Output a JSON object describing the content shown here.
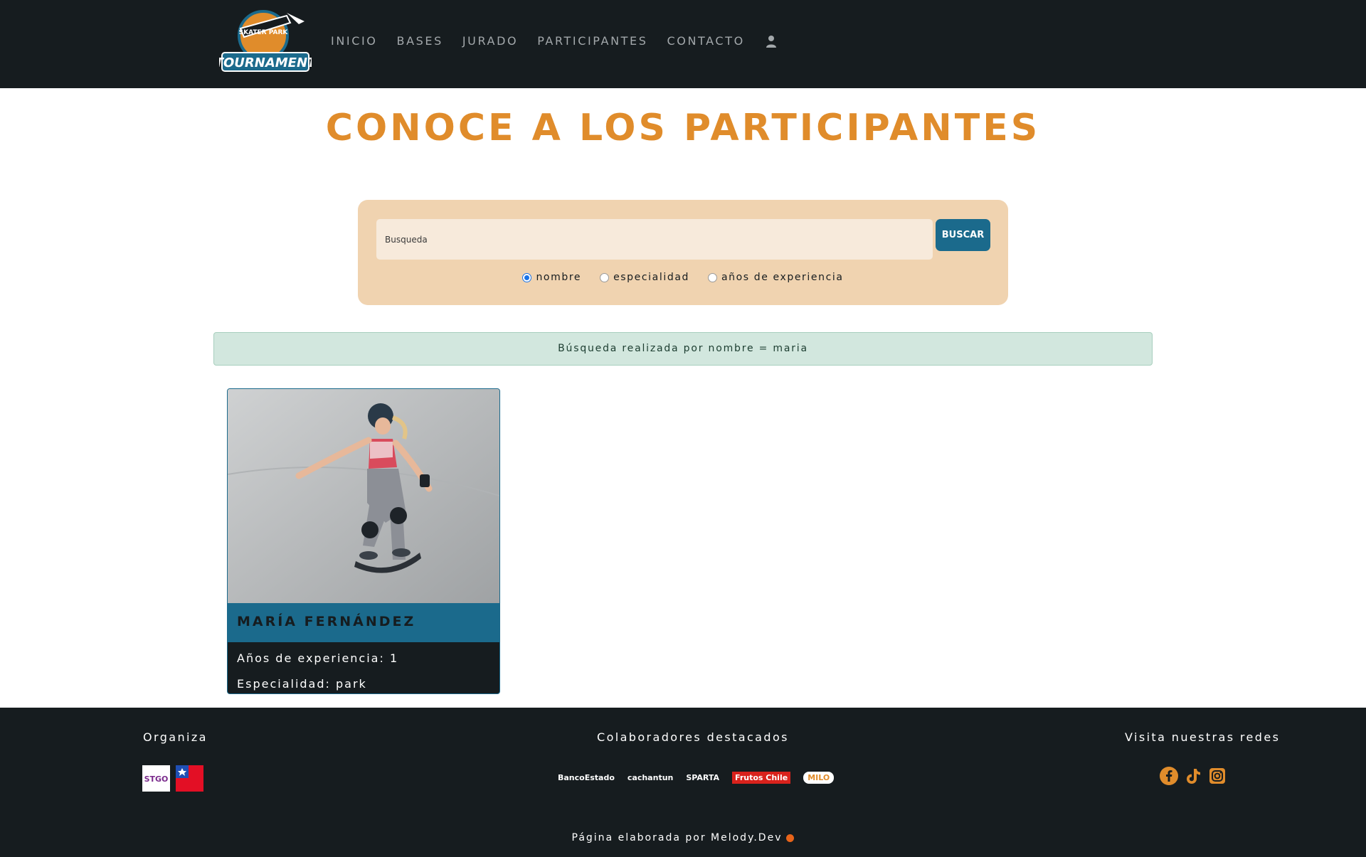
{
  "nav": {
    "logo_text": "TOURNAMENT",
    "logo_sub": "SKATER PARK",
    "items": [
      {
        "label": "INICIO"
      },
      {
        "label": "BASES"
      },
      {
        "label": "JURADO"
      },
      {
        "label": "PARTICIPANTES"
      },
      {
        "label": "CONTACTO"
      }
    ],
    "user_icon": "user-icon"
  },
  "page": {
    "title": "CONOCE A LOS PARTICIPANTES"
  },
  "search": {
    "placeholder": "Busqueda",
    "button_label": "BUSCAR",
    "options": [
      {
        "label": "nombre",
        "checked": true
      },
      {
        "label": "especialidad",
        "checked": false
      },
      {
        "label": "años de experiencia",
        "checked": false
      }
    ]
  },
  "alert": {
    "text": "Búsqueda realizada por nombre = maria"
  },
  "participants": [
    {
      "name": "MARÍA FERNÁNDEZ",
      "experience": "Años de experiencia: 1",
      "specialty": "Especialidad: park"
    }
  ],
  "footer": {
    "organiza_heading": "Organiza",
    "org_logo_text": "STGO",
    "collab_heading": "Colaboradores destacados",
    "collaborators": [
      "BancoEstado",
      "cachantun",
      "SPARTA",
      "Frutos Chile",
      "MILO"
    ],
    "social_heading": "Visita nuestras redes",
    "social_icons": [
      "facebook-icon",
      "tiktok-icon",
      "instagram-icon"
    ],
    "credit": "Página elaborada por Melody.Dev"
  },
  "colors": {
    "accent": "#e08c2b",
    "primary": "#1b6a8c",
    "dark": "#161c1f",
    "panel": "#f0d3b0",
    "alert_bg": "#d2e7de"
  }
}
